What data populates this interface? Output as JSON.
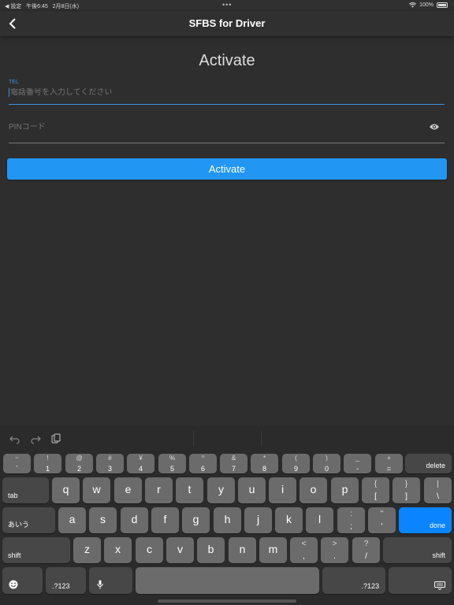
{
  "status": {
    "back_app": "◀ 設定",
    "time": "午後6:45",
    "date": "2月8日(水)",
    "dots": "•••",
    "battery": "100%"
  },
  "nav": {
    "title": "SFBS for Driver"
  },
  "form": {
    "title": "Activate",
    "tel_label": "TEL",
    "tel_placeholder": "電話番号を入力してください",
    "pin_placeholder": "PINコード",
    "button": "Activate"
  },
  "keyboard": {
    "row1": [
      [
        "~",
        "`"
      ],
      [
        "!",
        "1"
      ],
      [
        "@",
        "2"
      ],
      [
        "#",
        "3"
      ],
      [
        "¥",
        "4"
      ],
      [
        "%",
        "5"
      ],
      [
        "^",
        "6"
      ],
      [
        "&",
        "7"
      ],
      [
        "*",
        "8"
      ],
      [
        "(",
        "9"
      ],
      [
        ")",
        "0"
      ],
      [
        "_",
        "-"
      ],
      [
        "+",
        "="
      ]
    ],
    "row2": [
      "q",
      "w",
      "e",
      "r",
      "t",
      "y",
      "u",
      "i",
      "o",
      "p"
    ],
    "row2_sym": [
      [
        "{",
        "["
      ],
      [
        "}",
        "]"
      ],
      [
        "|",
        "\\"
      ]
    ],
    "row3": [
      "a",
      "s",
      "d",
      "f",
      "g",
      "h",
      "j",
      "k",
      "l"
    ],
    "row3_sym": [
      [
        ":",
        ";"
      ],
      [
        "\"",
        "'"
      ]
    ],
    "row4": [
      "z",
      "x",
      "c",
      "v",
      "b",
      "n",
      "m"
    ],
    "row4_sym": [
      [
        "<",
        ","
      ],
      [
        ">",
        "."
      ],
      [
        "?",
        "/"
      ]
    ],
    "labels": {
      "delete": "delete",
      "tab": "tab",
      "kana": "あいう",
      "done": "done",
      "shift": "shift",
      "num": ".?123"
    }
  }
}
